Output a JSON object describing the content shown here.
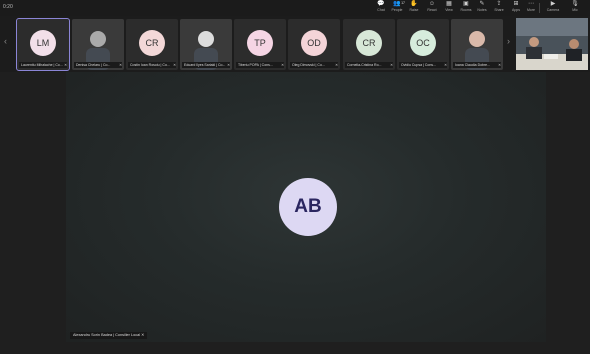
{
  "window": {
    "timer": "0:20"
  },
  "toolbar": {
    "items": [
      {
        "icon": "chat-icon",
        "glyph": "💬",
        "label": "Chat"
      },
      {
        "icon": "people-icon",
        "glyph": "👥",
        "label": "People",
        "badge": "17"
      },
      {
        "icon": "raise-hand-icon",
        "glyph": "✋",
        "label": "Raise"
      },
      {
        "icon": "react-icon",
        "glyph": "☺",
        "label": "React"
      },
      {
        "icon": "view-icon",
        "glyph": "▦",
        "label": "View"
      },
      {
        "icon": "rooms-icon",
        "glyph": "▣",
        "label": "Rooms"
      },
      {
        "icon": "notes-icon",
        "glyph": "✎",
        "label": "Notes"
      },
      {
        "icon": "share-icon",
        "glyph": "⇪",
        "label": "Share"
      },
      {
        "icon": "apps-icon",
        "glyph": "⊞",
        "label": "Apps"
      },
      {
        "icon": "more-icon",
        "glyph": "⋯",
        "label": "More"
      },
      {
        "icon": "camera-icon",
        "glyph": "▶",
        "label": "Camera"
      },
      {
        "icon": "mic-icon",
        "glyph": "🎙",
        "label": "Mic"
      }
    ]
  },
  "participants": [
    {
      "initials": "LM",
      "name": "Laurentiu Mihalache | Co...",
      "color": "#f2dfe9",
      "active": true
    },
    {
      "initials": "",
      "name": "Denisa Chelaru | Co...",
      "color": "#aaa",
      "photo": true
    },
    {
      "initials": "CR",
      "name": "Costin Ioan Rosoiu | Co...",
      "color": "#f3d8d8"
    },
    {
      "initials": "",
      "name": "Eduard Ilyes Sariakl | Co...",
      "color": "#ddd",
      "photo": true
    },
    {
      "initials": "TP",
      "name": "Tiberiu POPA | Cons...",
      "color": "#f5d5e4"
    },
    {
      "initials": "OD",
      "name": "Oleg Dimovski | Co...",
      "color": "#f4d4d8"
    },
    {
      "initials": "CR",
      "name": "Cornelia-Cristina Ro...",
      "color": "#d7e7d7"
    },
    {
      "initials": "OC",
      "name": "Ovidiu Cupsa | Cons...",
      "color": "#d6ecdc"
    },
    {
      "initials": "",
      "name": "Ioana Claudia Dobre...",
      "color": "#d9b9aa",
      "photo": true
    }
  ],
  "stage": {
    "initials": "AB",
    "name": "Alexandru Sorin Badea | Consilier Local"
  }
}
